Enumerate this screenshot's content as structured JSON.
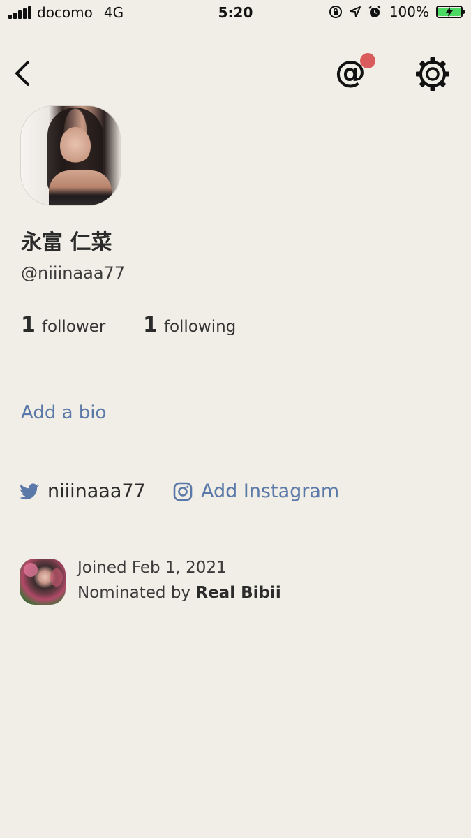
{
  "status_bar": {
    "carrier": "docomo",
    "network": "4G",
    "time": "5:20",
    "battery_percent": "100%",
    "icons": [
      "screen-lock-icon",
      "location-arrow-icon",
      "alarm-clock-icon",
      "battery-charging-icon"
    ],
    "battery_color": "#4cd964"
  },
  "nav": {
    "back_icon": "chevron-left-icon",
    "mentions_glyph": "@",
    "mentions_has_notification": true,
    "notification_color": "#d95b5b",
    "settings_icon": "gear-icon"
  },
  "profile": {
    "name": "永富 仁菜",
    "handle": "@niiinaaa77",
    "followers_count": "1",
    "followers_label": "follower",
    "following_count": "1",
    "following_label": "following",
    "add_bio_label": "Add a bio",
    "twitter_handle": "niiinaaa77",
    "instagram_label": "Add Instagram",
    "joined_text": "Joined Feb 1, 2021",
    "nominated_prefix": "Nominated by",
    "nominated_by": "Real Bibii"
  },
  "colors": {
    "background": "#f1eee7",
    "link": "#5a79a8",
    "twitter_blue": "#5a79a8"
  }
}
